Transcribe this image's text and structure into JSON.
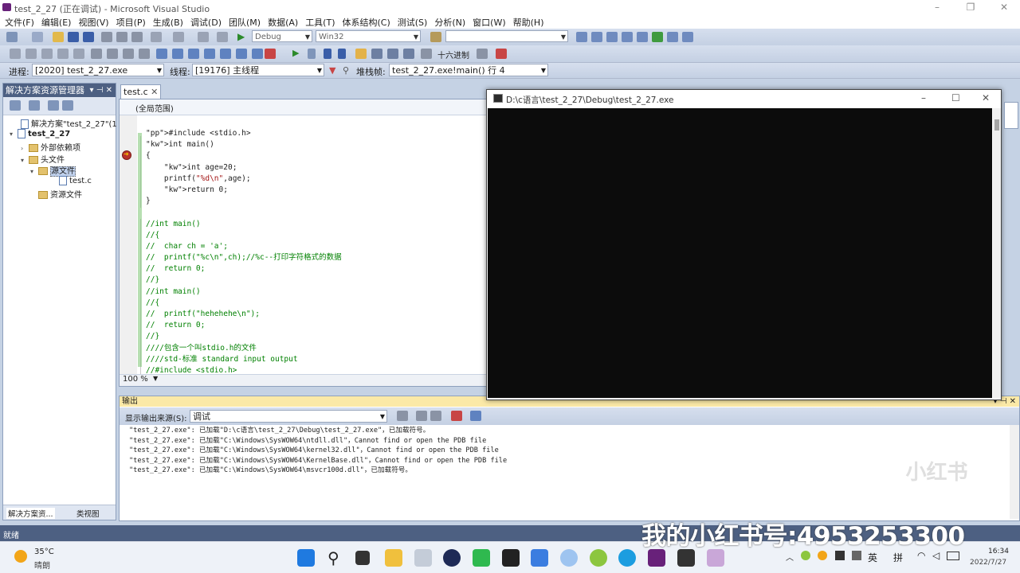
{
  "window": {
    "title": "test_2_27 (正在调试) - Microsoft Visual Studio"
  },
  "menu": [
    "文件(F)",
    "编辑(E)",
    "视图(V)",
    "项目(P)",
    "生成(B)",
    "调试(D)",
    "团队(M)",
    "数据(A)",
    "工具(T)",
    "体系结构(C)",
    "测试(S)",
    "分析(N)",
    "窗口(W)",
    "帮助(H)"
  ],
  "toolbar": {
    "config": "Debug",
    "platform": "Win32",
    "hex_label": "十六进制"
  },
  "debugbar": {
    "process_label": "进程:",
    "process_value": "[2020] test_2_27.exe",
    "thread_label": "线程:",
    "thread_value": "[19176] 主线程",
    "stack_label": "堆栈帧:",
    "stack_value": "test_2_27.exe!main() 行 4"
  },
  "solution": {
    "title": "解决方案资源管理器",
    "items": [
      {
        "label": "解决方案\"test_2_27\"(1 个项目)"
      },
      {
        "label": "test_2_27"
      },
      {
        "label": "外部依赖项"
      },
      {
        "label": "头文件"
      },
      {
        "label": "源文件"
      },
      {
        "label": "test.c"
      },
      {
        "label": "资源文件"
      }
    ],
    "tab_solution": "解决方案资...",
    "tab_class": "类视图"
  },
  "editor": {
    "tab": "test.c",
    "scope": "(全局范围)",
    "zoom": "100 %",
    "lines": [
      "#include <stdio.h>",
      "int main()",
      "{",
      "    int age=20;",
      "    printf(\"%d\\n\",age);",
      "    return 0;",
      "}",
      "",
      "//int main()",
      "//{",
      "//  char ch = 'a';",
      "//  printf(\"%c\\n\",ch);//%c--打印字符格式的数据",
      "//  return 0;",
      "//}",
      "//int main()",
      "//{",
      "//  printf(\"hehehehe\\n\");",
      "//  return 0;",
      "//}",
      "////包含一个叫stdio.h的文件",
      "////std-标准 standard input output",
      "//#include <stdio.h>"
    ]
  },
  "console": {
    "title": "D:\\c语言\\test_2_27\\Debug\\test_2_27.exe"
  },
  "output": {
    "title": "输出",
    "source_label": "显示输出来源(S):",
    "source_value": "调试",
    "lines": [
      "\"test_2_27.exe\": 已加载\"D:\\c语言\\test_2_27\\Debug\\test_2_27.exe\"，已加载符号。",
      "\"test_2_27.exe\": 已加载\"C:\\Windows\\SysWOW64\\ntdll.dll\"，Cannot find or open the PDB file",
      "\"test_2_27.exe\": 已加载\"C:\\Windows\\SysWOW64\\kernel32.dll\"，Cannot find or open the PDB file",
      "\"test_2_27.exe\": 已加载\"C:\\Windows\\SysWOW64\\KernelBase.dll\"，Cannot find or open the PDB file",
      "\"test_2_27.exe\": 已加载\"C:\\Windows\\SysWOW64\\msvcr100d.dll\"，已加载符号。"
    ]
  },
  "status": {
    "text": "就绪"
  },
  "taskbar": {
    "weather_temp": "35°C",
    "weather_desc": "晴朗",
    "ime_lang": "英",
    "ime_mode": "拼",
    "time": "16:34",
    "date": "2022/7/27"
  },
  "watermark": {
    "text": "我的小红书号:4953253300",
    "logo": "小红书"
  }
}
